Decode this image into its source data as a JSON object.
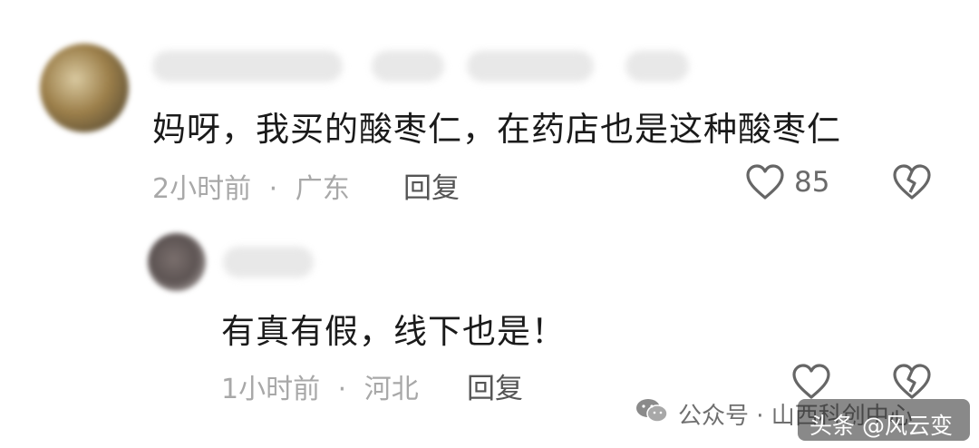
{
  "comment": {
    "text": "妈呀，我买的酸枣仁，在药店也是这种酸枣仁",
    "time": "2小时前",
    "separator": "·",
    "location": "广东",
    "reply_label": "回复",
    "like_count": "85"
  },
  "reply": {
    "text": "有真有假，线下也是！",
    "time": "1小时前",
    "separator": "·",
    "location": "河北",
    "reply_label": "回复"
  },
  "watermark": {
    "wechat_text": "公众号 · 山西科创中心",
    "toutiao_text": "头条 @风云变"
  },
  "colors": {
    "text": "#1a1a1a",
    "meta": "#a8a8a8",
    "icon": "#666666"
  }
}
